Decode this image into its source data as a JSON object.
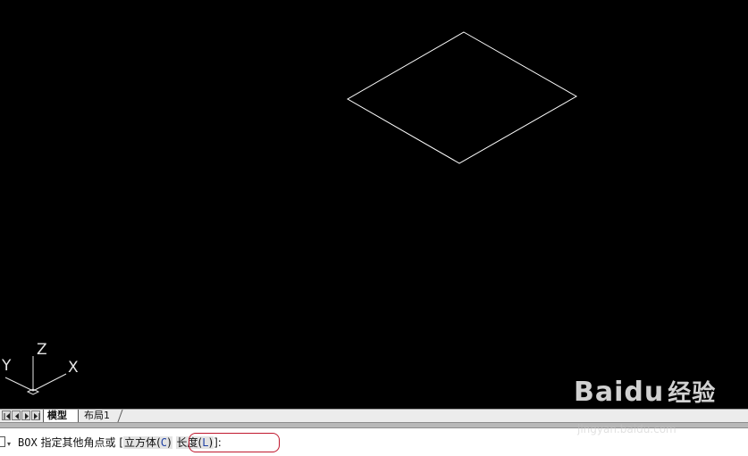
{
  "viewport": {
    "background": "#000000",
    "geometry_color": "#ffffff",
    "ucs_icon": {
      "x_label": "X",
      "y_label": "Y",
      "z_label": "Z"
    }
  },
  "tabs": {
    "items": [
      {
        "label": "模型",
        "active": true
      },
      {
        "label": "布局1",
        "active": false
      }
    ]
  },
  "command_line": {
    "command": "BOX",
    "prompt": "指定其他角点或",
    "open_bracket": "[",
    "options": [
      {
        "text": "立方体",
        "key": "C",
        "highlighted": false
      },
      {
        "text": "长度",
        "key": "L",
        "highlighted": true
      }
    ],
    "close": "]:",
    "highlight_color": "#c0182e"
  },
  "watermark": {
    "logo_text": "Baidu",
    "logo_suffix": "经验",
    "url": "jingyan.baidu.com"
  }
}
